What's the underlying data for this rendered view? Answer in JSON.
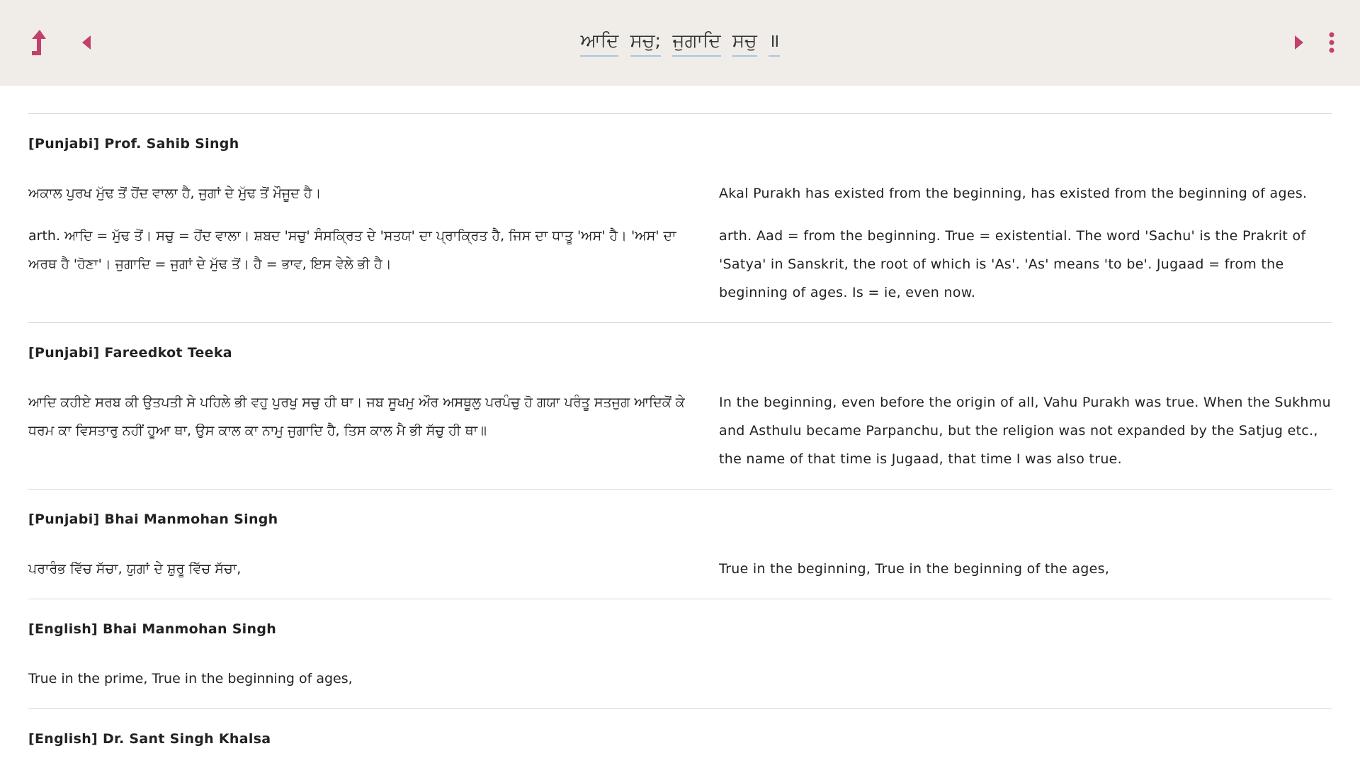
{
  "header": {
    "title_words": [
      "ਆਦਿ",
      "ਸਚੁ;",
      "ਜੁਗਾਦਿ",
      "ਸਚੁ",
      "॥"
    ],
    "accent_color": "#c2406b",
    "icons": {
      "up": "up-arrow-icon",
      "prev": "previous-triangle-icon",
      "next": "next-triangle-icon",
      "menu": "more-vertical-icon"
    }
  },
  "sections": [
    {
      "title": "[Punjabi] Prof. Sahib Singh",
      "rows": [
        {
          "left": "ਅਕਾਲ ਪੁਰਖ ਮੁੱਢ ਤੋਂ ਹੋਂਦ ਵਾਲਾ ਹੈ, ਜੁਗਾਂ ਦੇ ਮੁੱਢ ਤੋਂ ਮੌਜੂਦ ਹੈ।",
          "right": "Akal Purakh has existed from the beginning, has existed from the beginning of ages."
        },
        {
          "left": "arth. ਆਦਿ = ਮੁੱਢ ਤੋਂ। ਸਚੁ = ਹੋਂਦ ਵਾਲਾ। ਸ਼ਬਦ 'ਸਚੁ' ਸੰਸਕ੍ਰਿਤ ਦੇ 'ਸਤਯ' ਦਾ ਪ੍ਰਾਕ੍ਰਿਤ ਹੈ, ਜਿਸ ਦਾ ਧਾਤੂ 'ਅਸ' ਹੈ। 'ਅਸ' ਦਾ ਅਰਥ ਹੈ 'ਹੋਣਾ'। ਜੁਗਾਦਿ = ਜੁਗਾਂ ਦੇ ਮੁੱਢ ਤੋਂ। ਹੈ = ਭਾਵ, ਇਸ ਵੇਲੇ ਭੀ ਹੈ।",
          "right": "arth. Aad = from the beginning. True = existential. The word 'Sachu' is the Prakrit of 'Satya' in Sanskrit, the root of which is 'As'. 'As' means 'to be'. Jugaad = from the beginning of ages. Is = ie, even now."
        }
      ]
    },
    {
      "title": "[Punjabi] Fareedkot Teeka",
      "rows": [
        {
          "left": "ਆਦਿ ਕਹੀਏ ਸਰਬ ਕੀ ਉਤਪਤੀ ਸੇ ਪਹਿਲੇ ਭੀ ਵਹੁ ਪੁਰਖੁ ਸਚੁ ਹੀ ਥਾ। ਜਬ ਸੂਖਮੁ ਔਰ ਅਸਥੂਲੁ ਪਰਪੰਚੁ ਹੋ ਗਯਾ ਪਰੰਤੂ ਸਤਜੁਗ ਆਦਿਕੋਂ ਕੇ ਧਰਮ ਕਾ ਵਿਸਤਾਰੁ ਨਹੀਂ ਹੂਆ ਥਾ, ਉਸ ਕਾਲ ਕਾ ਨਾਮੁ ਜੁਗਾਦਿ ਹੈ, ਤਿਸ ਕਾਲ ਮੈ ਭੀ ਸੱਚੁ ਹੀ ਥਾ॥",
          "right": "In the beginning, even before the origin of all, Vahu Purakh was true. When the Sukhmu and Asthulu became Parpanchu, but the religion was not expanded by the Satjug etc., the name of that time is Jugaad, that time I was also true."
        }
      ]
    },
    {
      "title": "[Punjabi] Bhai Manmohan Singh",
      "rows": [
        {
          "left": "ਪਰਾਰੰਭ ਵਿੱਚ ਸੱਚਾ, ਯੁਗਾਂ ਦੇ ਸ਼ੁਰੂ ਵਿੱਚ ਸੱਚਾ,",
          "right": "True in the beginning, True in the beginning of the ages,"
        }
      ]
    },
    {
      "title": "[English] Bhai Manmohan Singh",
      "rows": [
        {
          "left": "True in the prime, True in the beginning of ages,",
          "right": ""
        }
      ]
    },
    {
      "title": "[English] Dr. Sant Singh Khalsa",
      "rows": []
    }
  ]
}
